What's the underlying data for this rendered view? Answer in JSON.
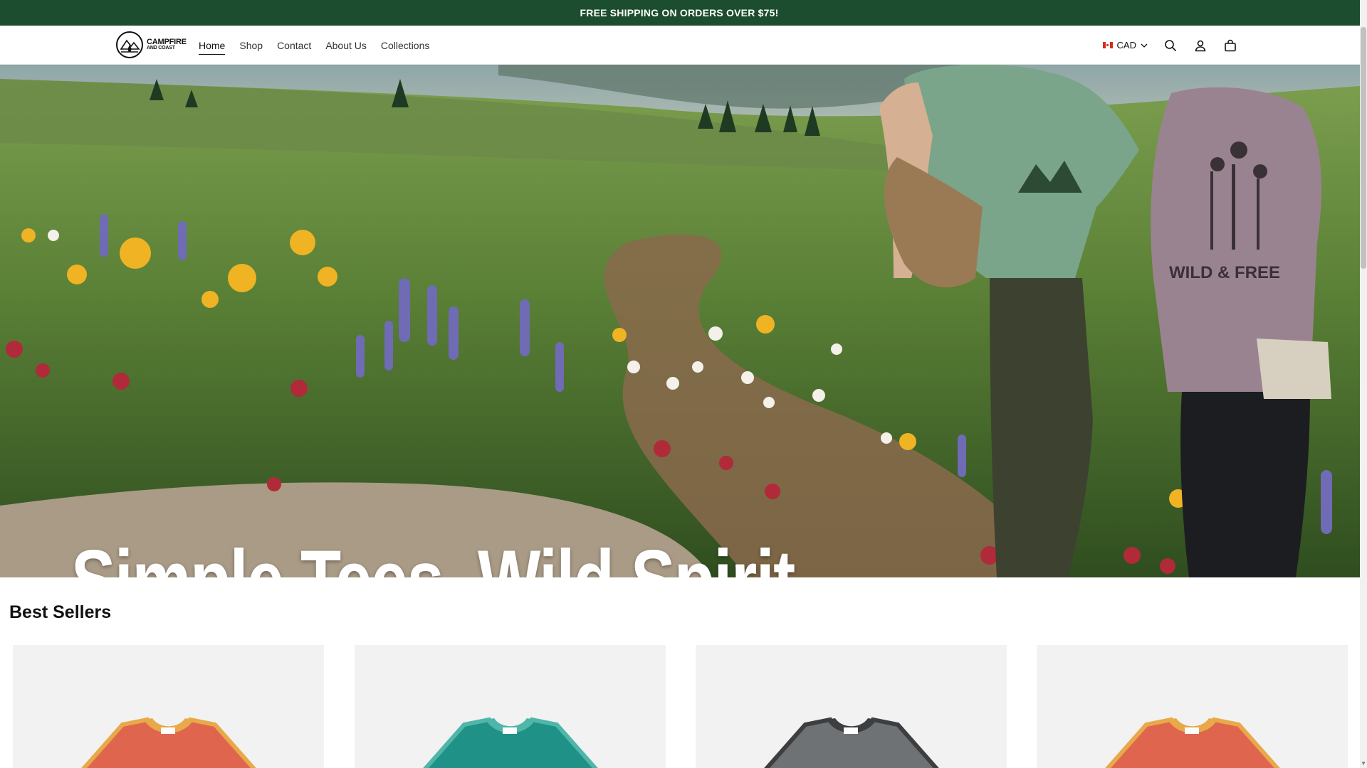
{
  "announcement": "FREE SHIPPING ON ORDERS OVER $75!",
  "brand": {
    "line1": "CAMPFIRE",
    "line2": "AND COAST"
  },
  "nav": [
    {
      "label": "Home",
      "active": true
    },
    {
      "label": "Shop",
      "active": false
    },
    {
      "label": "Contact",
      "active": false
    },
    {
      "label": "About Us",
      "active": false
    },
    {
      "label": "Collections",
      "active": false
    }
  ],
  "utils": {
    "currency": "CAD",
    "icons": [
      "search-icon",
      "account-icon",
      "cart-icon"
    ]
  },
  "hero": {
    "headline": "Simple Tees. Wild Spirit.",
    "shirt_graphic_text": "WILD & FREE"
  },
  "best_sellers": {
    "title": "Best Sellers",
    "products": [
      {
        "color": "#e0654e",
        "trim": "#e8a94a"
      },
      {
        "color": "#1f9186",
        "trim": "#4fb6a9"
      },
      {
        "color": "#6f7275",
        "trim": "#3c3e40"
      },
      {
        "color": "#e0654e",
        "trim": "#e8a94a"
      }
    ]
  },
  "colors": {
    "announcement_bg": "#1b4d2e",
    "text": "#111111"
  }
}
